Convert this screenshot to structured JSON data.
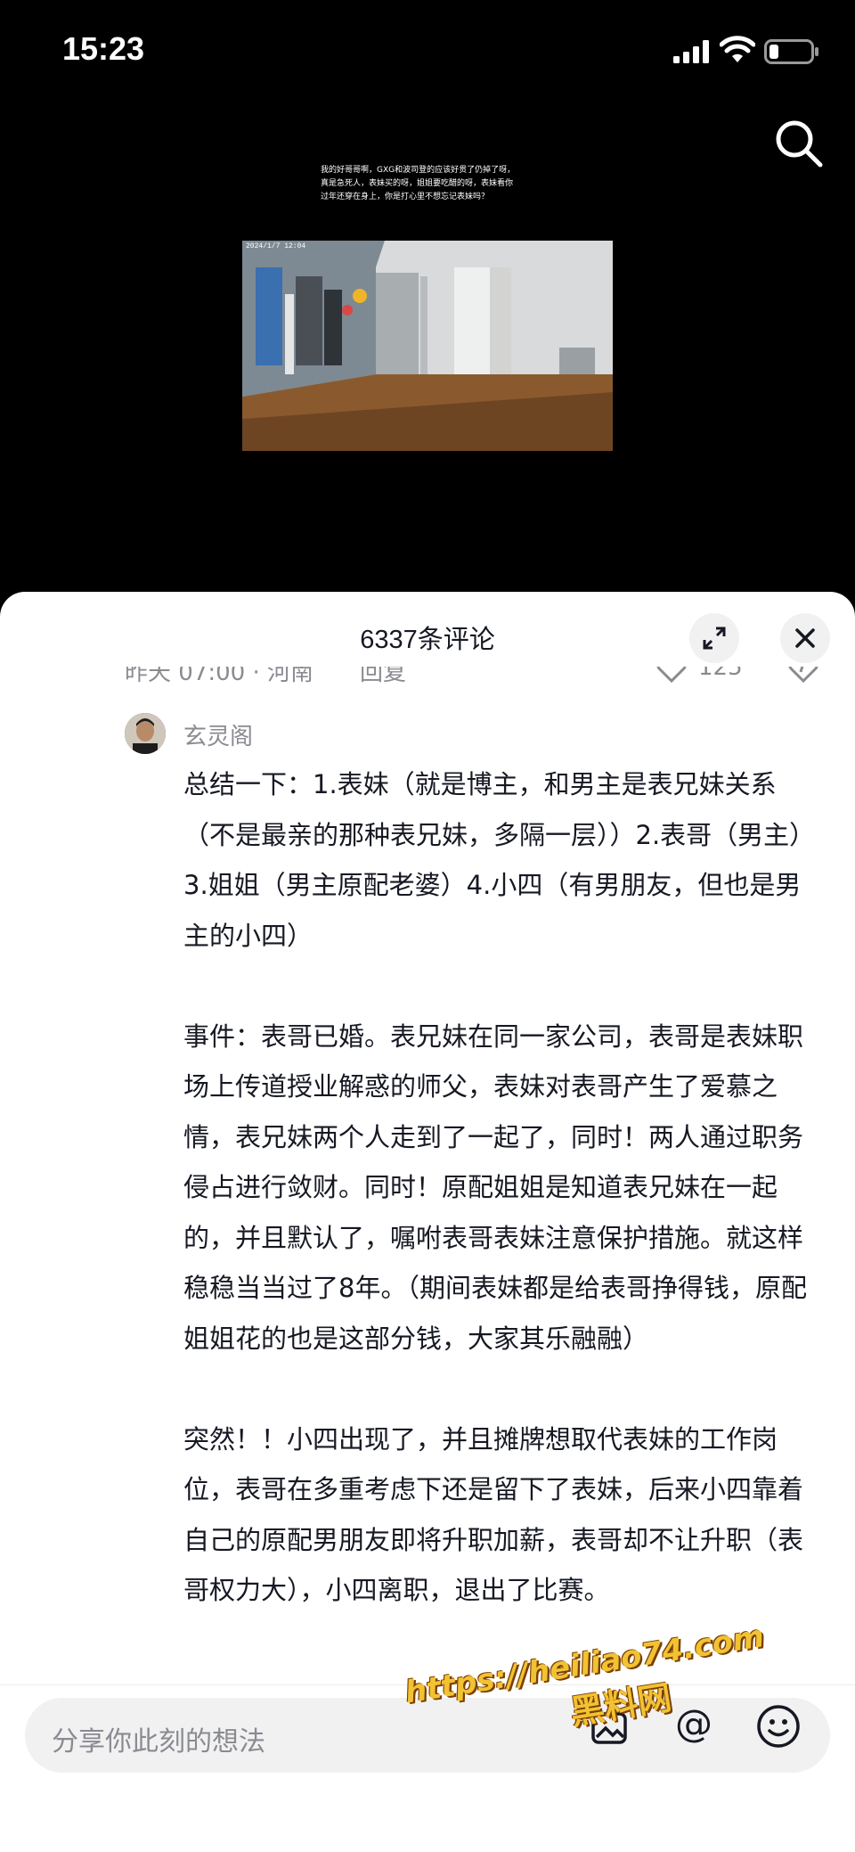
{
  "status": {
    "time": "15:23"
  },
  "video": {
    "caption": "我的好哥哥啊，GXG和波司登的应该好贯了仍掉了呀，真是急死人，表妹买的呀，姐姐要吃醋的呀，表妹看你过年还穿在身上，你是打心里不想忘记表妹吗？",
    "timestamp": "2024/1/7 12:04"
  },
  "comments": {
    "title": "6337条评论",
    "previous": {
      "meta": "昨天 07:00 · 河南",
      "reply_label": "回复",
      "likes": "125"
    },
    "current": {
      "author": "玄灵阁",
      "paragraphs": [
        "总结一下：1.表妹（就是博主，和男主是表兄妹关系（不是最亲的那种表兄妹，多隔一层））2.表哥（男主）3.姐姐（男主原配老婆）4.小四（有男朋友，但也是男主的小四）",
        "事件：表哥已婚。表兄妹在同一家公司，表哥是表妹职场上传道授业解惑的师父，表妹对表哥产生了爱慕之情，表兄妹两个人走到了一起了，同时！两人通过职务侵占进行敛财。同时！原配姐姐是知道表兄妹在一起的，并且默认了，嘱咐表哥表妹注意保护措施。就这样稳稳当当过了8年。（期间表妹都是给表哥挣得钱，原配姐姐花的也是这部分钱，大家其乐融融）",
        "突然！！小四出现了，并且摊牌想取代表妹的工作岗位，表哥在多重考虑下还是留下了表妹，后来小四靠着自己的原配男朋友即将升职加薪，表哥却不让升职（表哥权力大），小四离职，退出了比赛。"
      ]
    }
  },
  "input": {
    "placeholder": "分享你此刻的想法",
    "at_symbol": "@"
  },
  "watermark": {
    "url": "https://heiliao74.com",
    "name": "黑料网"
  }
}
